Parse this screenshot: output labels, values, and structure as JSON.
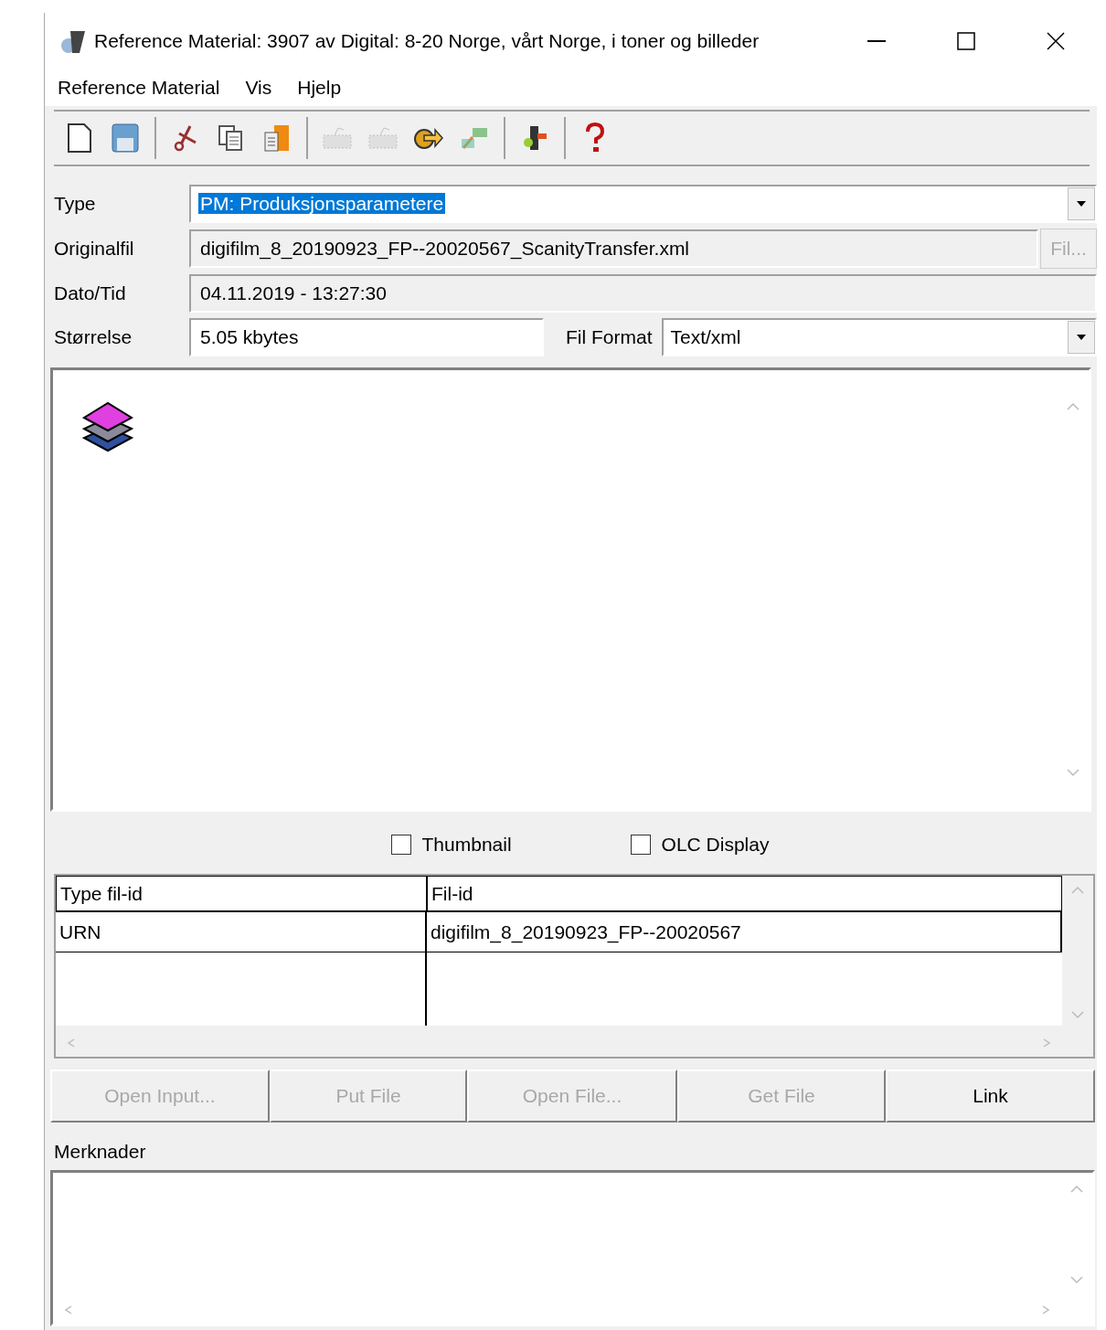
{
  "window": {
    "title": "Reference Material: 3907 av Digital: 8-20 Norge, vårt Norge, i toner og billeder"
  },
  "menu": [
    "Reference Material",
    "Vis",
    "Hjelp"
  ],
  "toolbar": [
    {
      "kind": "new",
      "disabled": false
    },
    {
      "kind": "save",
      "disabled": false
    },
    {
      "kind": "sep"
    },
    {
      "kind": "cut",
      "disabled": false
    },
    {
      "kind": "copy",
      "disabled": false
    },
    {
      "kind": "paste",
      "disabled": false
    },
    {
      "kind": "sep"
    },
    {
      "kind": "scan",
      "disabled": true
    },
    {
      "kind": "scan2",
      "disabled": true
    },
    {
      "kind": "forward",
      "disabled": false
    },
    {
      "kind": "link",
      "disabled": false
    },
    {
      "kind": "sep"
    },
    {
      "kind": "plug",
      "disabled": false
    },
    {
      "kind": "sep"
    },
    {
      "kind": "help",
      "disabled": false
    }
  ],
  "form": {
    "type": {
      "label": "Type",
      "value": "PM: Produksjonsparametere",
      "highlighted": true
    },
    "original": {
      "label": "Originalfil",
      "value": "digifilm_8_20190923_FP--20020567_ScanityTransfer.xml",
      "button": "Fil..."
    },
    "datetime": {
      "label": "Dato/Tid",
      "value": "04.11.2019 - 13:27:30"
    },
    "size": {
      "label": "Størrelse",
      "value": "5.05 kbytes"
    },
    "format": {
      "label": "Fil Format",
      "value": "Text/xml"
    }
  },
  "checkboxes": [
    {
      "label": "Thumbnail",
      "checked": false
    },
    {
      "label": "OLC Display",
      "checked": false
    }
  ],
  "table": {
    "columns": [
      "Type fil-id",
      "Fil-id"
    ],
    "rows": [
      [
        "URN",
        "digifilm_8_20190923_FP--20020567"
      ]
    ]
  },
  "buttons": [
    {
      "label": "Open Input...",
      "disabled": true
    },
    {
      "label": "Put File",
      "disabled": true
    },
    {
      "label": "Open File...",
      "disabled": true
    },
    {
      "label": "Get File",
      "disabled": true
    },
    {
      "label": "Link",
      "disabled": false
    }
  ],
  "notes": {
    "label": "Merknader"
  }
}
